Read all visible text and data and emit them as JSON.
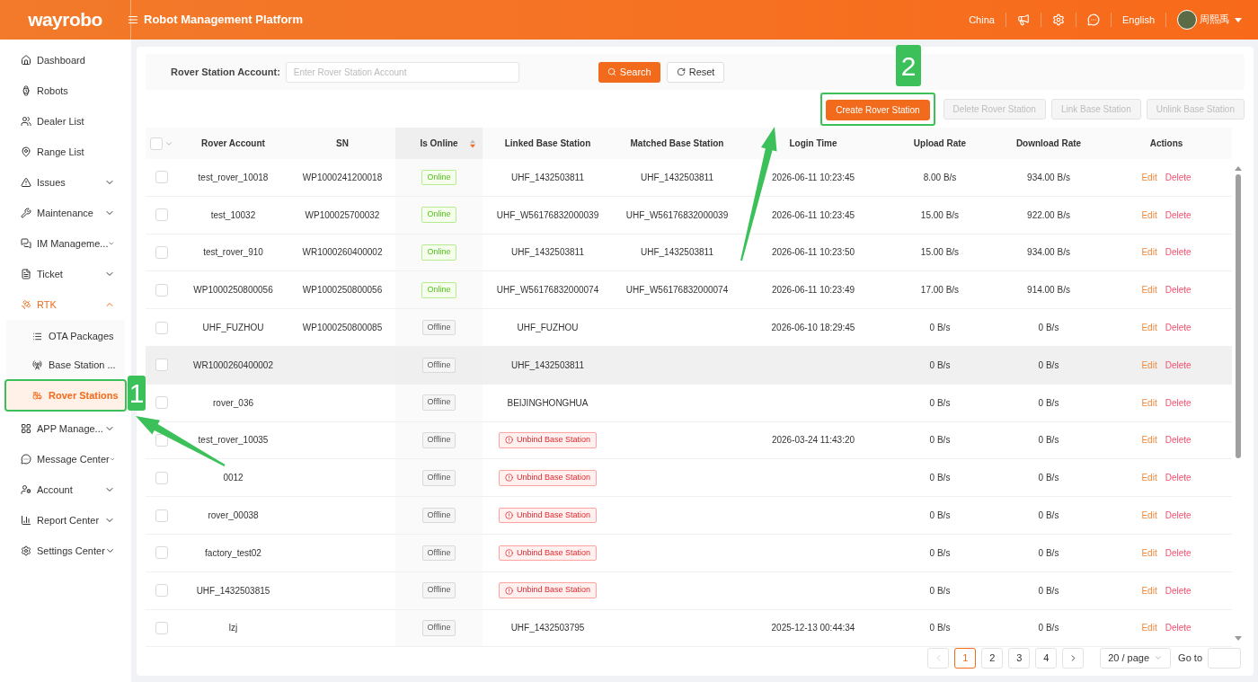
{
  "header": {
    "logo": "wayrobo",
    "title": "Robot Management Platform",
    "region": "China",
    "language": "English",
    "user": "周熙禹"
  },
  "sidebar": {
    "items": [
      {
        "label": "Dashboard",
        "selected": false
      },
      {
        "label": "Robots",
        "selected": false
      },
      {
        "label": "Dealer List",
        "selected": false
      },
      {
        "label": "Range List",
        "selected": false
      },
      {
        "label": "Issues",
        "expandable": true,
        "expanded": false,
        "selected": false
      },
      {
        "label": "Maintenance",
        "expandable": true,
        "expanded": false,
        "selected": false
      },
      {
        "label": "IM Manageme...",
        "expandable": true,
        "expanded": false,
        "selected": false
      },
      {
        "label": "Ticket",
        "expandable": true,
        "expanded": false,
        "selected": false
      },
      {
        "label": "RTK",
        "expandable": true,
        "expanded": true,
        "selected": true,
        "children": [
          {
            "label": "OTA Packages",
            "selected": false
          },
          {
            "label": "Base Station ...",
            "selected": false
          },
          {
            "label": "Rover Stations",
            "selected": true
          }
        ]
      },
      {
        "label": "APP Manage...",
        "expandable": true,
        "expanded": false,
        "selected": false
      },
      {
        "label": "Message Center",
        "expandable": true,
        "expanded": false,
        "selected": false
      },
      {
        "label": "Account",
        "expandable": true,
        "expanded": false,
        "selected": false
      },
      {
        "label": "Report Center",
        "expandable": true,
        "expanded": false,
        "selected": false
      },
      {
        "label": "Settings Center",
        "expandable": true,
        "expanded": false,
        "selected": false
      }
    ]
  },
  "search": {
    "label": "Rover Station Account:",
    "placeholder": "Enter Rover Station Account",
    "search_button": "Search",
    "reset_button": "Reset"
  },
  "toolbar": [
    {
      "label": "Create Rover Station",
      "disabled": false
    },
    {
      "label": "Delete Rover Station",
      "disabled": true
    },
    {
      "label": "Link Base Station",
      "disabled": true
    },
    {
      "label": "Unlink Base Station",
      "disabled": true
    }
  ],
  "table": {
    "select_all_checked": false,
    "columns": [
      "Rover Account",
      "SN",
      "Is Online",
      "Linked Base Station",
      "Matched Base Station",
      "Login Time",
      "Upload Rate",
      "Download Rate",
      "Actions"
    ],
    "rows": [
      {
        "checked": false,
        "hovered": false,
        "account": "test_rover_10018",
        "sn": "WP1000241200018",
        "online": true,
        "status": "Online",
        "linked": {
          "kind": "text",
          "text": "UHF_1432503811"
        },
        "matched": "UHF_1432503811",
        "login_time": "2026-06-11 10:23:45",
        "upload": "8.00 B/s",
        "download": "934.00 B/s",
        "actions": [
          "Edit",
          "Delete"
        ]
      },
      {
        "checked": false,
        "hovered": false,
        "account": "test_10032",
        "sn": "WP100025700032",
        "online": true,
        "status": "Online",
        "linked": {
          "kind": "text",
          "text": "UHF_W56176832000039"
        },
        "matched": "UHF_W56176832000039",
        "login_time": "2026-06-11 10:23:45",
        "upload": "15.00 B/s",
        "download": "922.00 B/s",
        "actions": [
          "Edit",
          "Delete"
        ]
      },
      {
        "checked": false,
        "hovered": false,
        "account": "test_rover_910",
        "sn": "WR1000260400002",
        "online": true,
        "status": "Online",
        "linked": {
          "kind": "text",
          "text": "UHF_1432503811"
        },
        "matched": "UHF_1432503811",
        "login_time": "2026-06-11 10:23:50",
        "upload": "15.00 B/s",
        "download": "934.00 B/s",
        "actions": [
          "Edit",
          "Delete"
        ]
      },
      {
        "checked": false,
        "hovered": false,
        "account": "WP1000250800056",
        "sn": "WP1000250800056",
        "online": true,
        "status": "Online",
        "linked": {
          "kind": "text",
          "text": "UHF_W56176832000074"
        },
        "matched": "UHF_W56176832000074",
        "login_time": "2026-06-11 10:23:49",
        "upload": "17.00 B/s",
        "download": "914.00 B/s",
        "actions": [
          "Edit",
          "Delete"
        ]
      },
      {
        "checked": false,
        "hovered": false,
        "account": "UHF_FUZHOU",
        "sn": "WP1000250800085",
        "online": false,
        "status": "Offline",
        "linked": {
          "kind": "text",
          "text": "UHF_FUZHOU"
        },
        "matched": "",
        "login_time": "2026-06-10 18:29:45",
        "upload": "0 B/s",
        "download": "0 B/s",
        "actions": [
          "Edit",
          "Delete"
        ]
      },
      {
        "checked": false,
        "hovered": true,
        "account": "WR1000260400002",
        "sn": "",
        "online": false,
        "status": "Offline",
        "linked": {
          "kind": "text",
          "text": "UHF_1432503811"
        },
        "matched": "",
        "login_time": "",
        "upload": "0 B/s",
        "download": "0 B/s",
        "actions": [
          "Edit",
          "Delete"
        ]
      },
      {
        "checked": false,
        "hovered": false,
        "account": "rover_036",
        "sn": "",
        "online": false,
        "status": "Offline",
        "linked": {
          "kind": "text",
          "text": "BEIJINGHONGHUA"
        },
        "matched": "",
        "login_time": "",
        "upload": "0 B/s",
        "download": "0 B/s",
        "actions": [
          "Edit",
          "Delete"
        ]
      },
      {
        "checked": false,
        "hovered": false,
        "account": "test_rover_10035",
        "sn": "",
        "online": false,
        "status": "Offline",
        "linked": {
          "kind": "warning",
          "text": "Unbind Base Station"
        },
        "matched": "",
        "login_time": "2026-03-24 11:43:20",
        "upload": "0 B/s",
        "download": "0 B/s",
        "actions": [
          "Edit",
          "Delete"
        ]
      },
      {
        "checked": false,
        "hovered": false,
        "account": "0012",
        "sn": "",
        "online": false,
        "status": "Offline",
        "linked": {
          "kind": "warning",
          "text": "Unbind Base Station"
        },
        "matched": "",
        "login_time": "",
        "upload": "0 B/s",
        "download": "0 B/s",
        "actions": [
          "Edit",
          "Delete"
        ]
      },
      {
        "checked": false,
        "hovered": false,
        "account": "rover_00038",
        "sn": "",
        "online": false,
        "status": "Offline",
        "linked": {
          "kind": "warning",
          "text": "Unbind Base Station"
        },
        "matched": "",
        "login_time": "",
        "upload": "0 B/s",
        "download": "0 B/s",
        "actions": [
          "Edit",
          "Delete"
        ]
      },
      {
        "checked": false,
        "hovered": false,
        "account": "factory_test02",
        "sn": "",
        "online": false,
        "status": "Offline",
        "linked": {
          "kind": "warning",
          "text": "Unbind Base Station"
        },
        "matched": "",
        "login_time": "",
        "upload": "0 B/s",
        "download": "0 B/s",
        "actions": [
          "Edit",
          "Delete"
        ]
      },
      {
        "checked": false,
        "hovered": false,
        "account": "UHF_1432503815",
        "sn": "",
        "online": false,
        "status": "Offline",
        "linked": {
          "kind": "warning",
          "text": "Unbind Base Station"
        },
        "matched": "",
        "login_time": "",
        "upload": "0 B/s",
        "download": "0 B/s",
        "actions": [
          "Edit",
          "Delete"
        ]
      },
      {
        "checked": false,
        "hovered": false,
        "account": "lzj",
        "sn": "",
        "online": false,
        "status": "Offline",
        "linked": {
          "kind": "text",
          "text": "UHF_1432503795"
        },
        "matched": "",
        "login_time": "2025-12-13 00:44:34",
        "upload": "0 B/s",
        "download": "0 B/s",
        "actions": [
          "Edit",
          "Delete"
        ]
      }
    ]
  },
  "pagination": {
    "pages": [
      {
        "label": "1",
        "selected": true
      },
      {
        "label": "2",
        "selected": false
      },
      {
        "label": "3",
        "selected": false
      },
      {
        "label": "4",
        "selected": false
      }
    ],
    "prev_disabled": true,
    "page_size": "20 / page",
    "goto_label": "Go to"
  },
  "annotations": [
    {
      "label": "1"
    },
    {
      "label": "2"
    }
  ]
}
